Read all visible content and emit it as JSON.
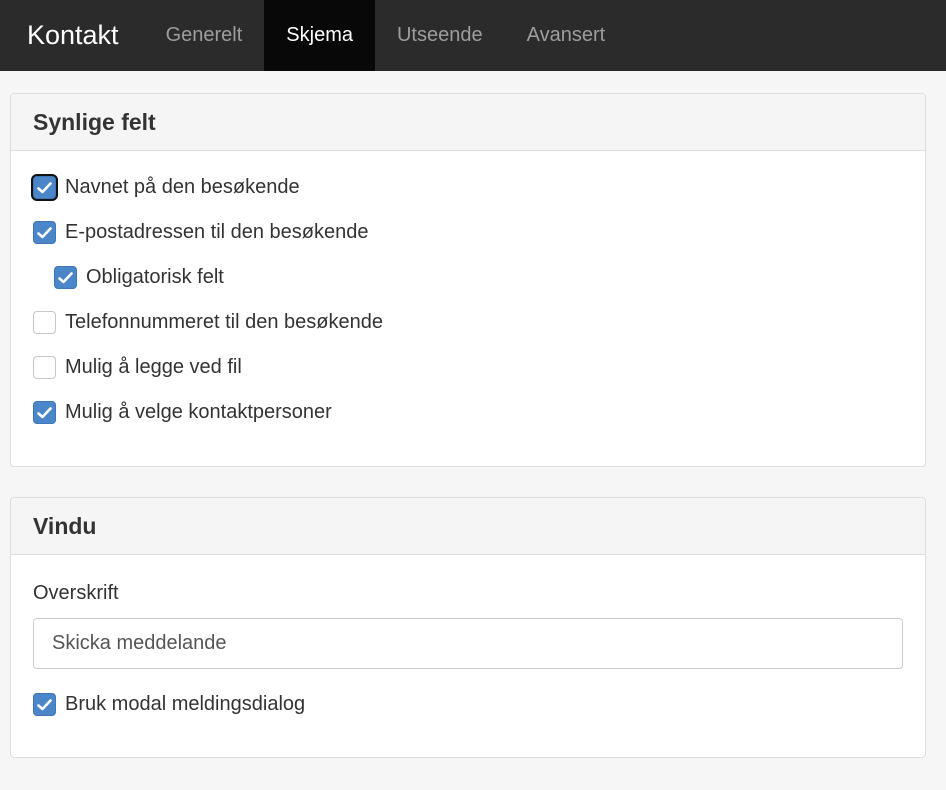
{
  "navbar": {
    "brand": "Kontakt",
    "tabs": [
      {
        "label": "Generelt",
        "active": false
      },
      {
        "label": "Skjema",
        "active": true
      },
      {
        "label": "Utseende",
        "active": false
      },
      {
        "label": "Avansert",
        "active": false
      }
    ]
  },
  "visible_fields": {
    "heading": "Synlige felt",
    "items": [
      {
        "label": "Navnet på den besøkende",
        "checked": true,
        "indent": false
      },
      {
        "label": "E-postadressen til den besøkende",
        "checked": true,
        "indent": false
      },
      {
        "label": "Obligatorisk felt",
        "checked": true,
        "indent": true
      },
      {
        "label": "Telefonnummeret til den besøkende",
        "checked": false,
        "indent": false
      },
      {
        "label": "Mulig å legge ved fil",
        "checked": false,
        "indent": false
      },
      {
        "label": "Mulig å velge kontaktpersoner",
        "checked": true,
        "indent": false
      }
    ]
  },
  "window": {
    "heading": "Vindu",
    "title_label": "Overskrift",
    "title_value": "Skicka meddelande",
    "modal": {
      "label": "Bruk modal meldingsdialog",
      "checked": true
    }
  },
  "colors": {
    "navbar_bg": "#2b2b2b",
    "active_tab_bg": "#080808",
    "checkbox_checked": "#4a86c8"
  }
}
